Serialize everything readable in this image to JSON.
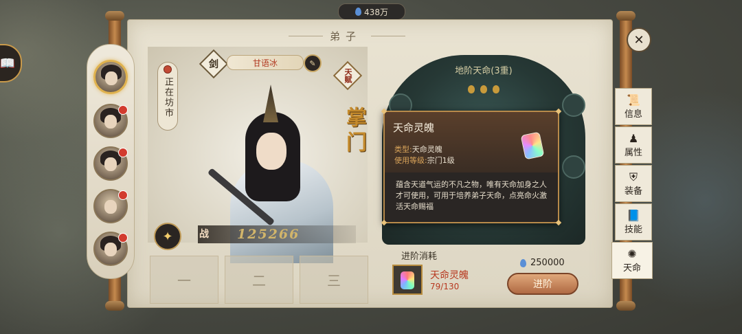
{
  "header": {
    "currency_value": "438万"
  },
  "scroll": {
    "title": "弟子"
  },
  "disciples": {
    "items": [
      {
        "name": "disciple-1",
        "selected": true,
        "has_alert": false
      },
      {
        "name": "disciple-2",
        "selected": false,
        "has_alert": true
      },
      {
        "name": "disciple-3",
        "selected": false,
        "has_alert": true
      },
      {
        "name": "disciple-4",
        "selected": false,
        "has_alert": true
      },
      {
        "name": "disciple-5",
        "selected": false,
        "has_alert": true
      }
    ]
  },
  "character": {
    "weapon_type": "剑",
    "name": "甘语冰",
    "talent": "天赋",
    "status": "正在坊市",
    "rank": "掌门",
    "power_label": "战",
    "power_value": "125266",
    "slots": [
      "一",
      "二",
      "三"
    ]
  },
  "destiny": {
    "title": "地阶天命(3重)",
    "cost_label": "进阶消耗",
    "cost_item_name": "天命灵魄",
    "cost_item_count": "79/130",
    "coin_amount": "250000",
    "advance_button": "进阶"
  },
  "tabs": [
    {
      "id": "info",
      "label": "信息",
      "icon": "scroll-icon"
    },
    {
      "id": "attributes",
      "label": "属性",
      "icon": "figure-icon"
    },
    {
      "id": "equipment",
      "label": "装备",
      "icon": "armor-icon"
    },
    {
      "id": "skills",
      "label": "技能",
      "icon": "book-icon"
    },
    {
      "id": "destiny",
      "label": "天命",
      "icon": "destiny-icon",
      "active": true
    }
  ],
  "tooltip": {
    "title": "天命灵魄",
    "type_key": "类型:",
    "type_value": "天命灵魄",
    "level_key": "使用等级:",
    "level_value": "宗门1级",
    "description": "蕴含天道气运的不凡之物，唯有天命加身之人才可使用，可用于培养弟子天命，点亮命火激活天命赐福"
  },
  "colors": {
    "accent_gold": "#c48a2c",
    "alert_red": "#d23b2e",
    "cost_red": "#b7381f"
  }
}
